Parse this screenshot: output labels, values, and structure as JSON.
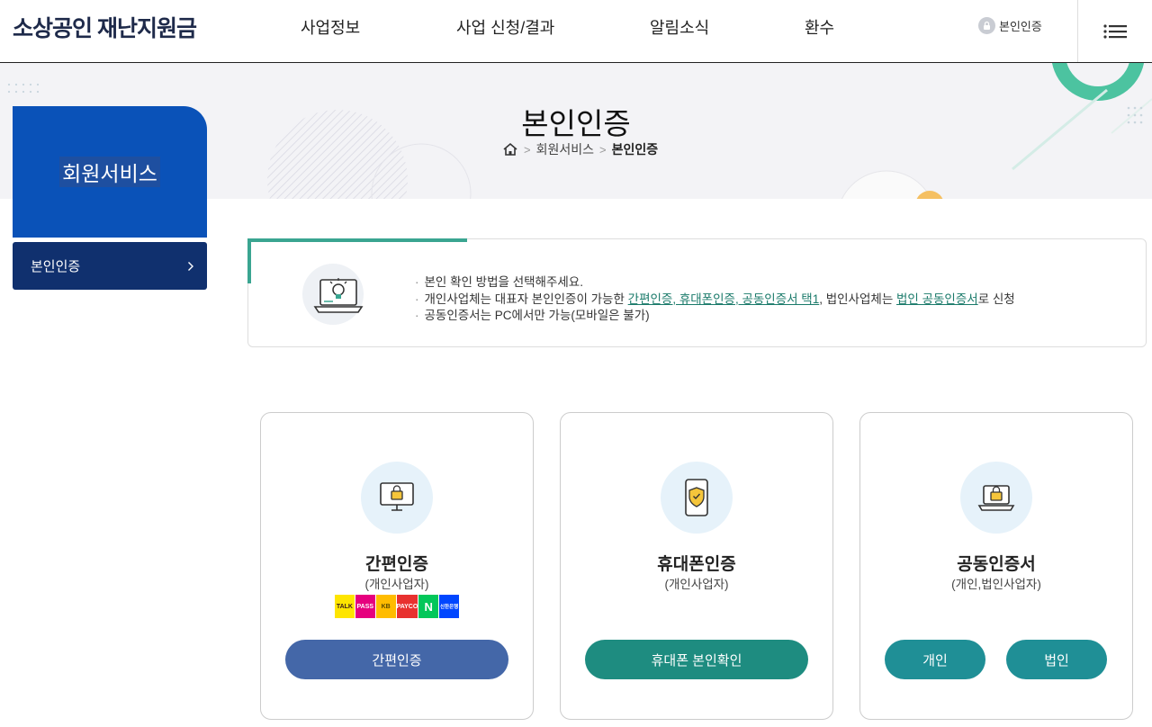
{
  "header": {
    "logo": "소상공인 재난지원금",
    "nav": [
      "사업정보",
      "사업 신청/결과",
      "알림소식",
      "환수"
    ],
    "cert_label": "본인인증"
  },
  "visual": {
    "title": "본인인증",
    "breadcrumb": [
      "회원서비스",
      "본인인증"
    ]
  },
  "sidebar": {
    "title": "회원서비스",
    "items": [
      {
        "label": "본인인증"
      }
    ]
  },
  "notice": {
    "line1": "본인 확인 방법을 선택해주세요.",
    "line2_pre": "개인사업체는 대표자 본인인증이 가능한 ",
    "line2_link1": "간편인증, 휴대폰인증, 공동인증서 택1",
    "line2_mid": ", 법인사업체는 ",
    "line2_link2": "법인 공동인증서",
    "line2_post": "로 신청",
    "line3": "공동인증서는 PC에서만 가능(모바일은 불가)"
  },
  "cards": [
    {
      "title": "간편인증",
      "sub": "(개인사업자)",
      "providers": [
        "TALK",
        "PASS",
        "KB",
        "PAYCO",
        "N",
        "신한은행"
      ],
      "buttons": [
        "간편인증"
      ]
    },
    {
      "title": "휴대폰인증",
      "sub": "(개인사업자)",
      "buttons": [
        "휴대폰 본인확인"
      ]
    },
    {
      "title": "공동인증서",
      "sub": "(개인,법인사업자)",
      "buttons": [
        "개인",
        "법인"
      ]
    }
  ],
  "colors": {
    "sidebar_head": "#0a52b8",
    "sidebar_item": "#10306e",
    "accent_green": "#3aa591",
    "btn_blue": "#4467a8",
    "btn_teal": "#1e8c80",
    "btn_cyan": "#1f8f96"
  }
}
